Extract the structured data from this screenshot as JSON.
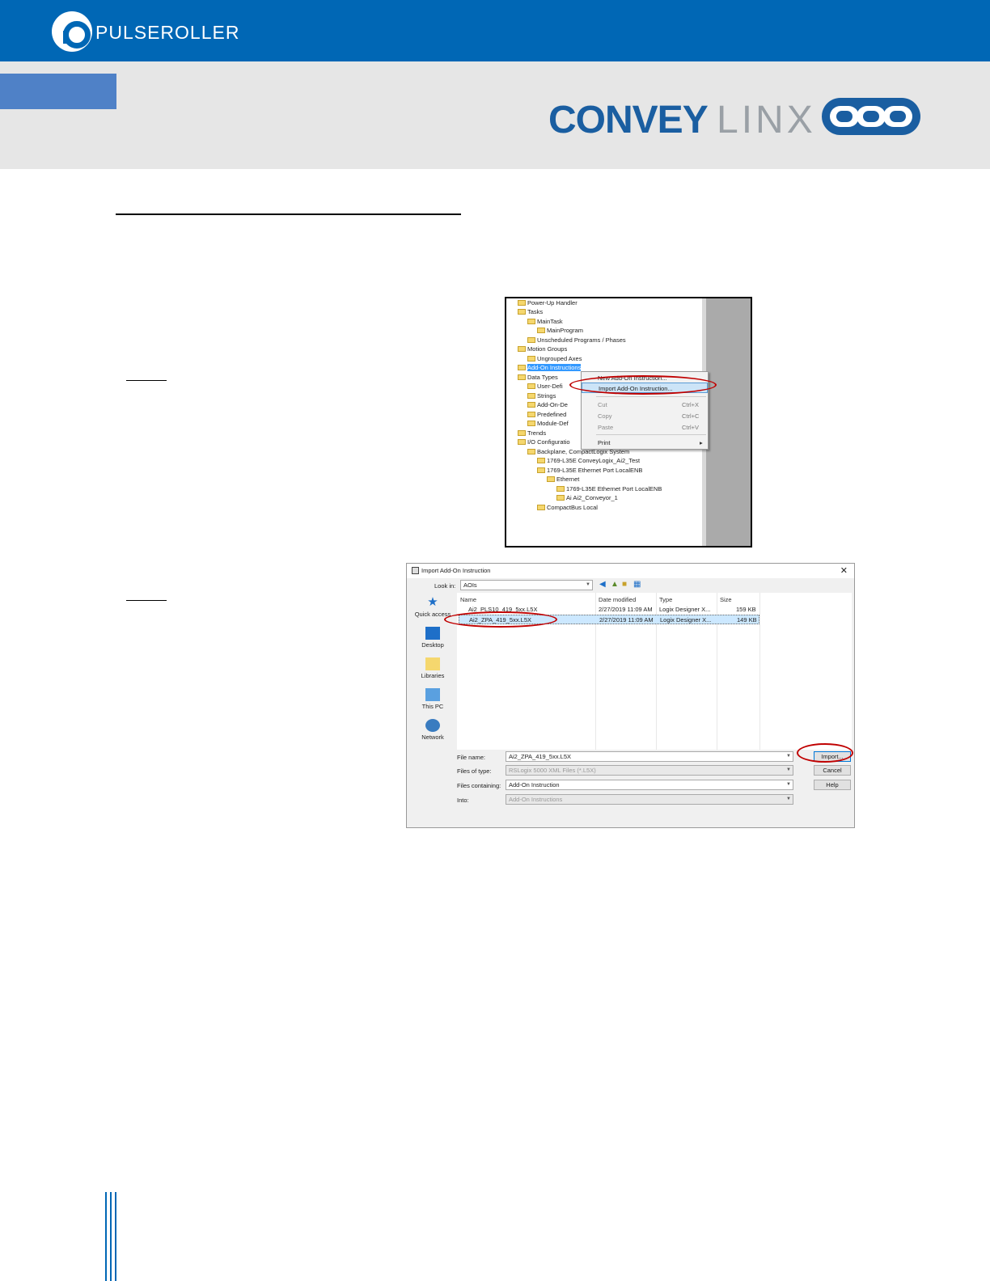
{
  "header": {
    "brand": "PULSEROLLER",
    "product_bold": "CONVEY",
    "product_light": "LINX"
  },
  "screenshot1": {
    "tree": [
      {
        "label": "Power-Up Handler"
      },
      {
        "label": "Tasks"
      },
      {
        "label": "MainTask"
      },
      {
        "label": "MainProgram"
      },
      {
        "label": "Unscheduled Programs / Phases"
      },
      {
        "label": "Motion Groups"
      },
      {
        "label": "Ungrouped Axes"
      },
      {
        "label": "Add-On Instructions"
      },
      {
        "label": "Data Types"
      },
      {
        "label": "User-Defi"
      },
      {
        "label": "Strings"
      },
      {
        "label": "Add-On-De"
      },
      {
        "label": "Predefined"
      },
      {
        "label": "Module-Def"
      },
      {
        "label": "Trends"
      },
      {
        "label": "I/O Configuratio"
      },
      {
        "label": "Backplane, CompactLogix System"
      },
      {
        "label": "1769-L35E ConveyLogix_Ai2_Test"
      },
      {
        "label": "1769-L35E Ethernet Port LocalENB"
      },
      {
        "label": "Ethernet"
      },
      {
        "label": "1769-L35E Ethernet Port LocalENB"
      },
      {
        "label": "Ai Ai2_Conveyor_1"
      },
      {
        "label": "CompactBus Local"
      }
    ],
    "context_menu": {
      "new": "New Add-On Instruction...",
      "import": "Import Add-On Instruction...",
      "cut": "Cut",
      "cut_sc": "Ctrl+X",
      "copy": "Copy",
      "copy_sc": "Ctrl+C",
      "paste": "Paste",
      "paste_sc": "Ctrl+V",
      "print": "Print"
    }
  },
  "screenshot2": {
    "title": "Import Add-On Instruction",
    "look_in_label": "Look in:",
    "look_in_value": "AOIs",
    "places": [
      "Quick access",
      "Desktop",
      "Libraries",
      "This PC",
      "Network"
    ],
    "columns": {
      "name": "Name",
      "date": "Date modified",
      "type": "Type",
      "size": "Size"
    },
    "files": [
      {
        "name": "Ai2_PLS10_419_5xx.L5X",
        "date": "2/27/2019 11:09 AM",
        "type": "Logix Designer X...",
        "size": "159 KB"
      },
      {
        "name": "Ai2_ZPA_419_5xx.L5X",
        "date": "2/27/2019 11:09 AM",
        "type": "Logix Designer X...",
        "size": "149 KB"
      }
    ],
    "file_name_label": "File name:",
    "file_name_value": "Ai2_ZPA_419_5xx.L5X",
    "files_type_label": "Files of type:",
    "files_type_value": "RSLogix 5000 XML Files (*.L5X)",
    "files_containing_label": "Files containing:",
    "files_containing_value": "Add-On Instruction",
    "into_label": "Into:",
    "into_value": "Add-On Instructions",
    "btn_import": "Import...",
    "btn_cancel": "Cancel",
    "btn_help": "Help"
  }
}
